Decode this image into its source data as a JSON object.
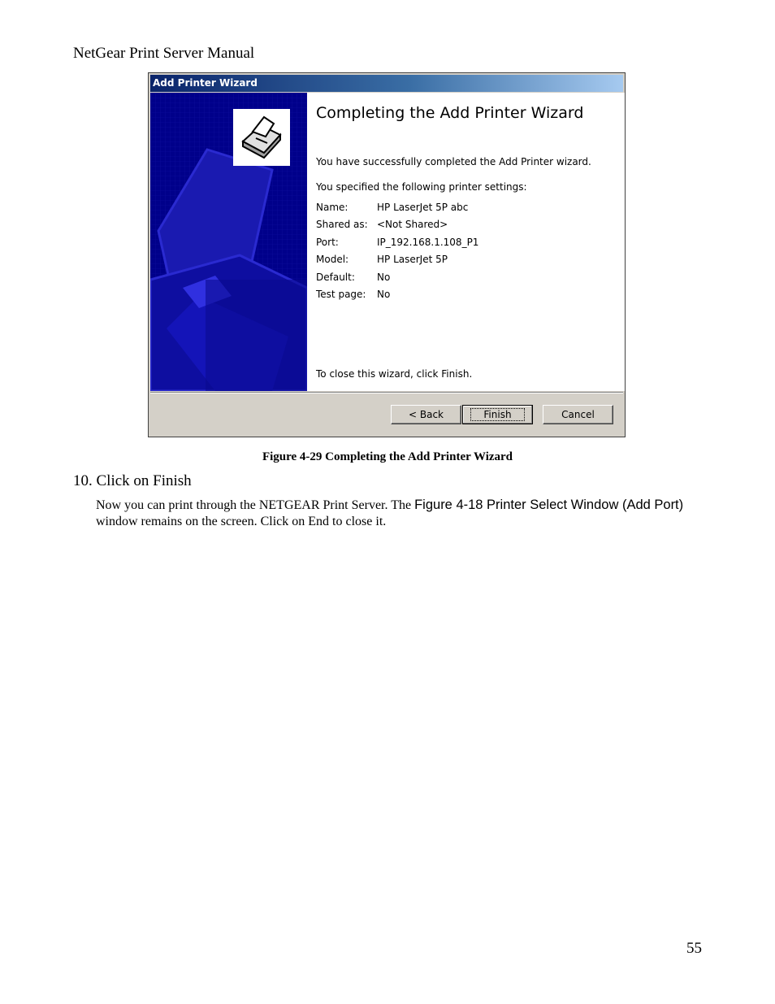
{
  "header": {
    "running_title": "NetGear Print Server Manual"
  },
  "dialog": {
    "title": "Add Printer Wizard",
    "heading": "Completing the Add Printer Wizard",
    "success_text": "You have successfully completed the Add Printer wizard.",
    "settings_intro": "You specified the following printer settings:",
    "settings": [
      {
        "label": "Name:",
        "value": "HP LaserJet 5P abc"
      },
      {
        "label": "Shared as:",
        "value": "<Not Shared>"
      },
      {
        "label": "Port:",
        "value": "IP_192.168.1.108_P1"
      },
      {
        "label": "Model:",
        "value": "HP LaserJet 5P"
      },
      {
        "label": "Default:",
        "value": "No"
      },
      {
        "label": "Test page:",
        "value": "No"
      }
    ],
    "close_hint": "To close this wizard, click Finish.",
    "buttons": {
      "back": "< Back",
      "finish": "Finish",
      "cancel": "Cancel"
    },
    "icon": "printer-icon"
  },
  "caption": "Figure 4-29 Completing the Add Printer Wizard",
  "step": "10. Click on Finish",
  "body": {
    "before": "Now you can print through the NETGEAR Print Server. The ",
    "reference": "Figure 4-18 Printer Select Window (Add Port)",
    "after": " window remains on the screen. Click on End to close it."
  },
  "page_number": "55"
}
